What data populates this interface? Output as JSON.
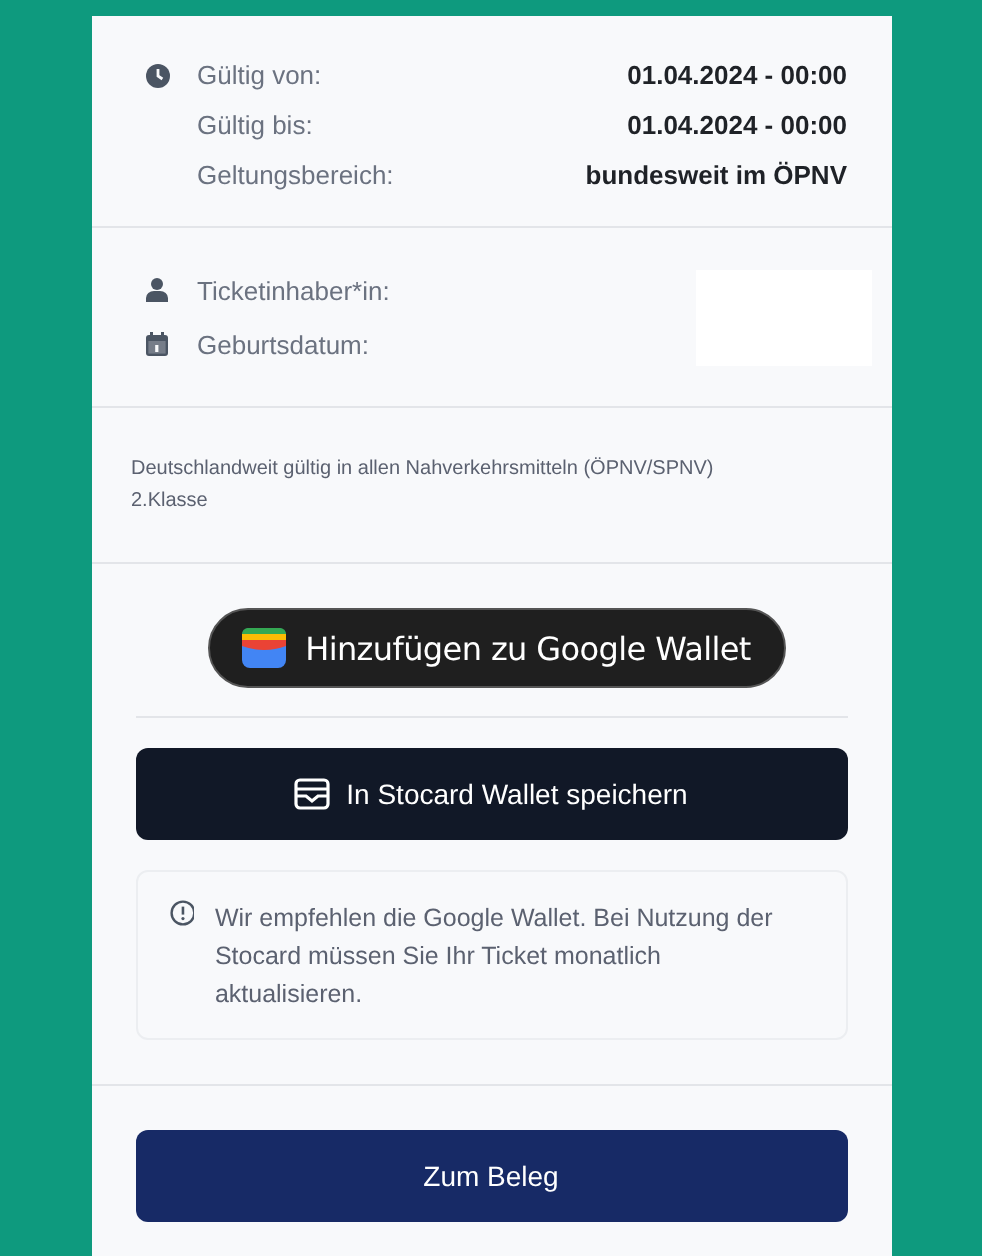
{
  "validity": [
    {
      "label": "Gültig von:",
      "value": "01.04.2024 - 00:00"
    },
    {
      "label": "Gültig bis:",
      "value": "01.04.2024 - 00:00"
    },
    {
      "label": "Geltungsbereich:",
      "value": "bundesweit im ÖPNV"
    }
  ],
  "holder": [
    {
      "label": "Ticketinhaber*in:"
    },
    {
      "label": "Geburtsdatum:"
    }
  ],
  "description": "Deutschlandweit gültig in allen Nahverkehrsmitteln (ÖPNV/SPNV)\n2.Klasse",
  "google_wallet_button": "Hinzufügen zu Google Wallet",
  "stocard_button": "In Stocard Wallet speichern",
  "notice": "Wir empfehlen die Google Wallet. Bei Nutzung der Stocard müssen Sie Ihr Ticket monatlich aktualisieren.",
  "receipt_button": "Zum Beleg"
}
